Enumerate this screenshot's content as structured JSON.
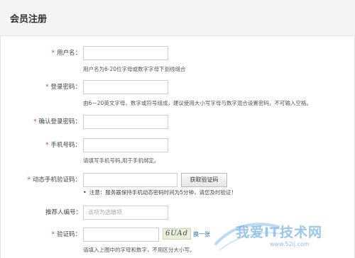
{
  "header": {
    "title": "会员注册"
  },
  "form": {
    "username": {
      "label": "用户名：",
      "hint": "用户名为6-20位字母或数字字母下划线组合"
    },
    "password": {
      "label": "登录密码：",
      "hint": "由6—20英文字母、数字或符号组成，建议使用大小写字母与数字混合设置密码，不可输入空格。"
    },
    "confirm_password": {
      "label": "确认登录密码："
    },
    "phone": {
      "label": "手机号码：",
      "hint": "请填写手机号码,用于手机绑定。"
    },
    "sms_code": {
      "label": "动态手机验证码：",
      "button": "获取验证码",
      "notice_bullet": "•",
      "notice": "注意：服务器保持手机动态密码时间为5分钟，请您及时验证！"
    },
    "referrer": {
      "label": "推荐人编号：",
      "placeholder": "该项为选填项"
    },
    "captcha": {
      "label": "验证码：",
      "image_text": "6UAd",
      "refresh": "换一张",
      "hint": "请填入上图中的字母和数字，不用区分大小写。"
    },
    "required_mark": "*"
  },
  "watermark": {
    "text": "我爱IT技术网",
    "url": "www.52ij.com"
  }
}
